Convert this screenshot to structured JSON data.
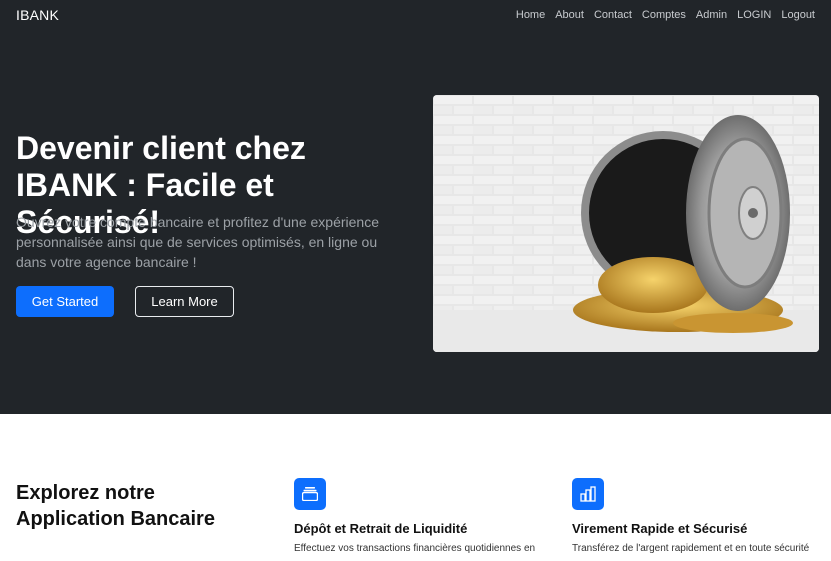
{
  "navbar": {
    "brand": "IBANK",
    "links": [
      "Home",
      "About",
      "Contact",
      "Comptes",
      "Admin",
      "LOGIN",
      "Logout"
    ]
  },
  "hero": {
    "title": "Devenir client chez IBANK : Facile et Sécurisé!",
    "subtitle": "Ouvrez votre compte bancaire et profitez d'une expérience personnalisée ainsi que de services optimisés, en ligne ou dans votre agence bancaire !",
    "primary_button": "Get Started",
    "secondary_button": "Learn More",
    "image_icon": "bank-vault-with-gold-coins"
  },
  "features": {
    "title": "Explorez notre Application Bancaire",
    "items": [
      {
        "icon": "collection-icon",
        "title": "Dépôt et Retrait de Liquidité",
        "text": "Effectuez vos transactions financières quotidiennes en"
      },
      {
        "icon": "building-icon",
        "title": "Virement Rapide et Sécurisé",
        "text": "Transférez de l'argent rapidement et en toute sécurité"
      }
    ]
  },
  "colors": {
    "dark_bg": "#212529",
    "primary": "#0d6efd"
  }
}
